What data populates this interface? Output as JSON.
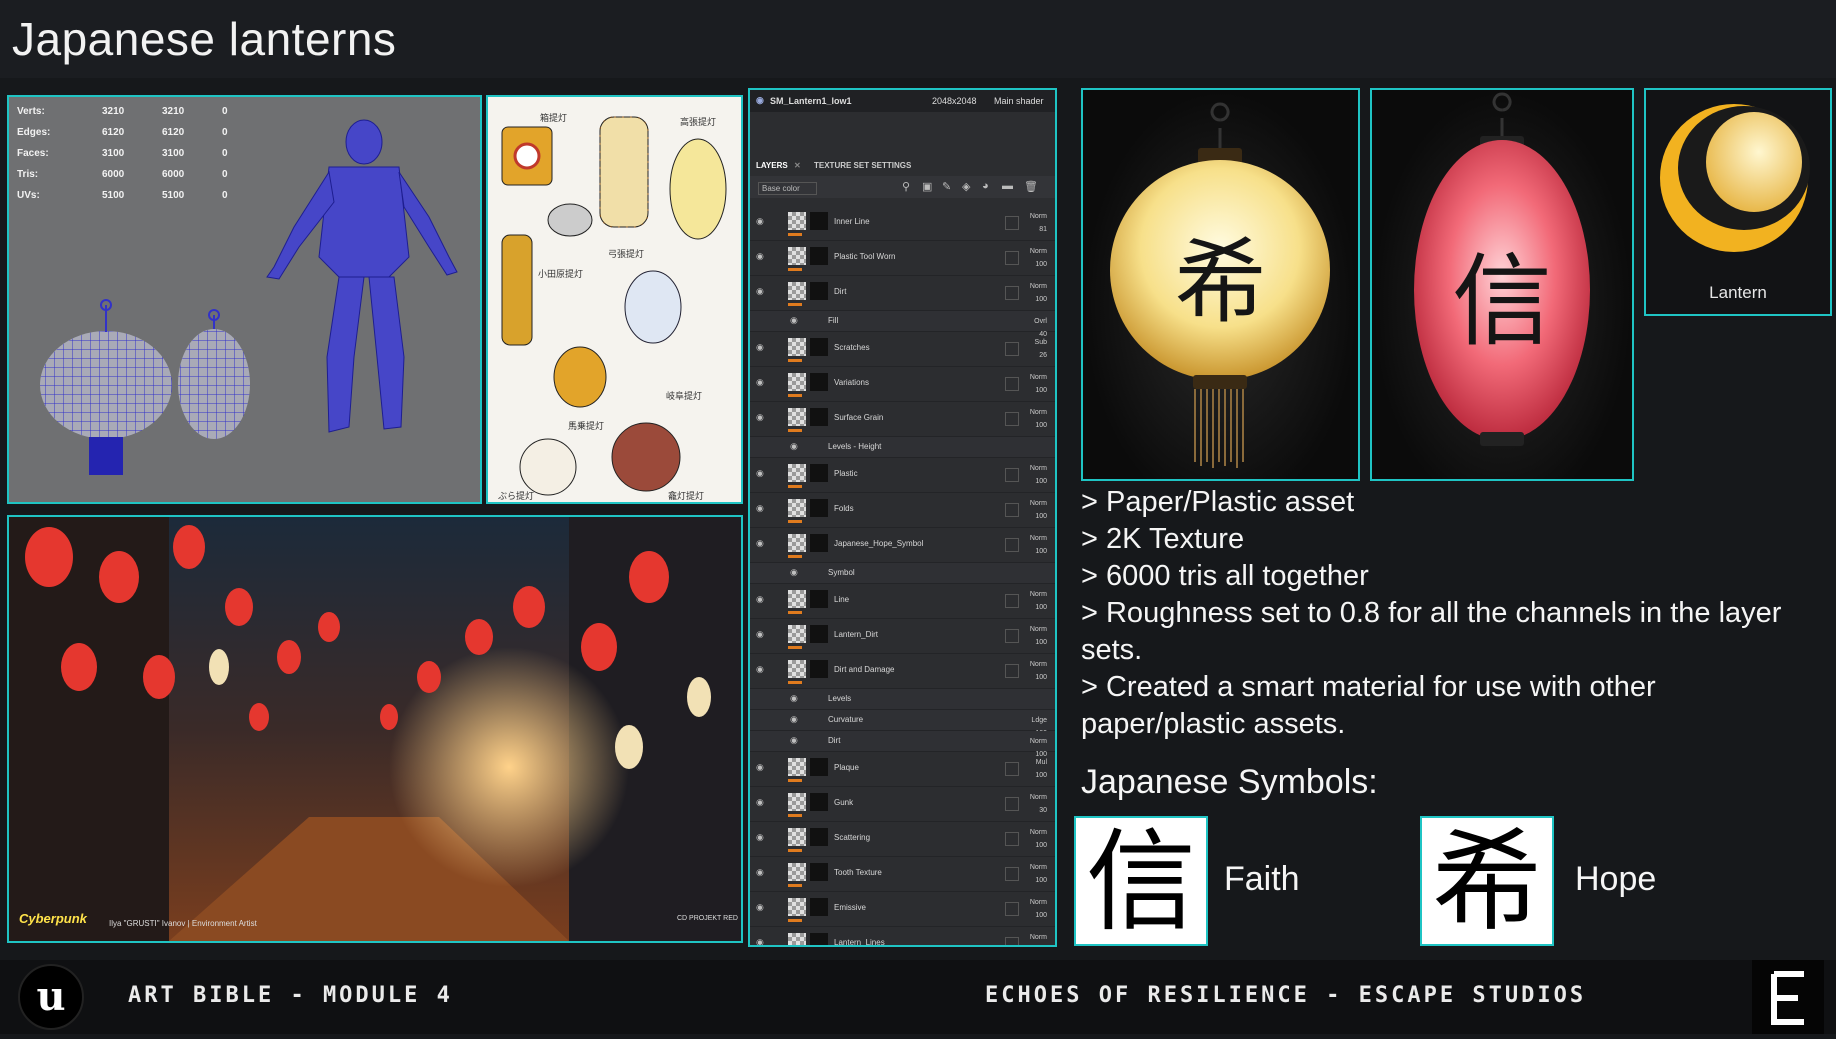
{
  "title": "Japanese lanterns",
  "stats": {
    "rows": [
      {
        "label": "Verts:",
        "a": "3210",
        "b": "3210",
        "c": "0"
      },
      {
        "label": "Edges:",
        "a": "6120",
        "b": "6120",
        "c": "0"
      },
      {
        "label": "Faces:",
        "a": "3100",
        "b": "3100",
        "c": "0"
      },
      {
        "label": "Tris:",
        "a": "6000",
        "b": "6000",
        "c": "0"
      },
      {
        "label": "UVs:",
        "a": "5100",
        "b": "5100",
        "c": "0"
      }
    ]
  },
  "reference_labels": [
    "箱提灯",
    "高張提灯",
    "弓張提灯",
    "小田原提灯",
    "岐阜提灯",
    "馬乗提灯",
    "ぶら提灯",
    "龕灯提灯"
  ],
  "street_credits": {
    "logo": "Cyberpunk",
    "artist": "Ilya \"GRUSTI\" Ivanov | Environment Artist",
    "studio": "CD PROJEKT RED"
  },
  "painter": {
    "asset": "SM_Lantern1_low1",
    "resolution": "2048x2048",
    "shader": "Main shader",
    "tab_layers": "LAYERS",
    "tab_texture": "TEXTURE SET SETTINGS",
    "channel": "Base color",
    "layers": [
      {
        "name": "Inner Line",
        "blend": "Norm",
        "opacity": "81",
        "sub": false
      },
      {
        "name": "Plastic Tool Worn",
        "blend": "Norm",
        "opacity": "100",
        "sub": false
      },
      {
        "name": "Dirt",
        "blend": "Norm",
        "opacity": "100",
        "sub": false
      },
      {
        "name": "Fill",
        "blend": "Ovrl",
        "opacity": "40",
        "sub": true
      },
      {
        "name": "Scratches",
        "blend": "Sub",
        "opacity": "26",
        "sub": false
      },
      {
        "name": "Variations",
        "blend": "Norm",
        "opacity": "100",
        "sub": false
      },
      {
        "name": "Surface Grain",
        "blend": "Norm",
        "opacity": "100",
        "sub": false
      },
      {
        "name": "Levels - Height",
        "blend": "",
        "opacity": "",
        "sub": true
      },
      {
        "name": "Plastic",
        "blend": "Norm",
        "opacity": "100",
        "sub": false
      },
      {
        "name": "Folds",
        "blend": "Norm",
        "opacity": "100",
        "sub": false
      },
      {
        "name": "Japanese_Hope_Symbol",
        "blend": "Norm",
        "opacity": "100",
        "sub": false
      },
      {
        "name": "Symbol",
        "blend": "",
        "opacity": "",
        "sub": true
      },
      {
        "name": "Line",
        "blend": "Norm",
        "opacity": "100",
        "sub": false
      },
      {
        "name": "Lantern_Dirt",
        "blend": "Norm",
        "opacity": "100",
        "sub": false
      },
      {
        "name": "Dirt and Damage",
        "blend": "Norm",
        "opacity": "100",
        "sub": false
      },
      {
        "name": "Levels",
        "blend": "",
        "opacity": "",
        "sub": true
      },
      {
        "name": "Curvature",
        "blend": "Ldge",
        "opacity": "100",
        "sub": true
      },
      {
        "name": "Dirt",
        "blend": "Norm",
        "opacity": "100",
        "sub": true
      },
      {
        "name": "Plaque",
        "blend": "Mul",
        "opacity": "100",
        "sub": false
      },
      {
        "name": "Gunk",
        "blend": "Norm",
        "opacity": "30",
        "sub": false
      },
      {
        "name": "Scattering",
        "blend": "Norm",
        "opacity": "100",
        "sub": false
      },
      {
        "name": "Tooth Texture",
        "blend": "Norm",
        "opacity": "100",
        "sub": false
      },
      {
        "name": "Emissive",
        "blend": "Norm",
        "opacity": "100",
        "sub": false
      },
      {
        "name": "Lantern_Lines",
        "blend": "Norm",
        "opacity": "100",
        "sub": false
      }
    ]
  },
  "renders": {
    "yellow_symbol": "希",
    "red_symbol": "信",
    "bowl_label": "Lantern"
  },
  "bullets": [
    "> Paper/Plastic asset",
    "> 2K Texture",
    "> 6000 tris all together",
    "> Roughness set to 0.8 for all the channels in the layer sets.",
    "> Created a smart material for use with other paper/plastic assets."
  ],
  "symbols": {
    "title": "Japanese Symbols:",
    "faith_glyph": "信",
    "faith_label": "Faith",
    "hope_glyph": "希",
    "hope_label": "Hope"
  },
  "footer": {
    "left": "ART BIBLE - MODULE 4",
    "right": "ECHOES OF RESILIENCE - ESCAPE STUDIOS"
  },
  "colors": {
    "accent": "#1fc4c4",
    "yellow_lantern": "#f3d76a",
    "red_lantern": "#e8485a"
  }
}
